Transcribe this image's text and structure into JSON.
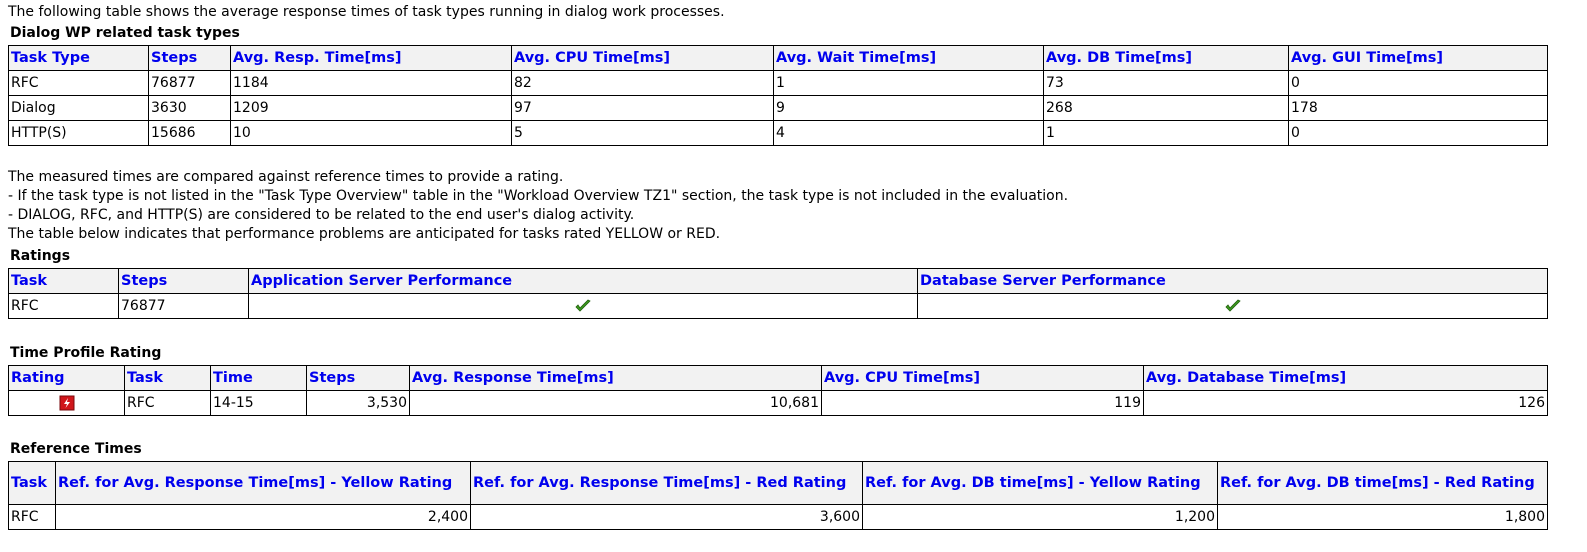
{
  "intro": "The following table shows the average response times of task types running in dialog work processes.",
  "dialog_wp": {
    "title": "Dialog WP related task types",
    "headers": [
      "Task Type",
      "Steps",
      "Avg. Resp. Time[ms]",
      "Avg. CPU Time[ms]",
      "Avg. Wait Time[ms]",
      "Avg. DB Time[ms]",
      "Avg. GUI Time[ms]"
    ],
    "rows": [
      [
        "RFC",
        "76877",
        "1184",
        "82",
        "1",
        "73",
        "0"
      ],
      [
        "Dialog",
        "3630",
        "1209",
        "97",
        "9",
        "268",
        "178"
      ],
      [
        "HTTP(S)",
        "15686",
        "10",
        "5",
        "4",
        "1",
        "0"
      ]
    ]
  },
  "notes": [
    "The measured times are compared against reference times to provide a rating.",
    "- If the task type is not listed in the \"Task Type Overview\" table in the \"Workload Overview TZ1\" section, the task type is not included in the evaluation.",
    "- DIALOG, RFC, and HTTP(S) are considered to be related to the end user's dialog activity.",
    "The table below indicates that performance problems are anticipated for tasks rated YELLOW or RED."
  ],
  "ratings": {
    "title": "Ratings",
    "headers": [
      "Task",
      "Steps",
      "Application Server Performance",
      "Database Server Performance"
    ],
    "rows": [
      {
        "task": "RFC",
        "steps": "76877",
        "app_icon": "green-check-icon",
        "db_icon": "green-check-icon"
      }
    ]
  },
  "time_profile": {
    "title": "Time Profile Rating",
    "headers": [
      "Rating",
      "Task",
      "Time",
      "Steps",
      "Avg. Response Time[ms]",
      "Avg. CPU Time[ms]",
      "Avg. Database Time[ms]"
    ],
    "rows": [
      {
        "rating_icon": "red-rating-icon",
        "task": "RFC",
        "time": "14-15",
        "steps": "3,530",
        "avg_resp": "10,681",
        "avg_cpu": "119",
        "avg_db": "126"
      }
    ]
  },
  "reference": {
    "title": "Reference Times",
    "headers": [
      "Task",
      "Ref. for Avg. Response Time[ms] - Yellow Rating",
      "Ref. for Avg. Response Time[ms] - Red Rating",
      "Ref. for Avg. DB time[ms] - Yellow Rating",
      "Ref. for Avg. DB time[ms] - Red Rating"
    ],
    "rows": [
      [
        "RFC",
        "2,400",
        "3,600",
        "1,200",
        "1,800"
      ]
    ]
  },
  "colors": {
    "header_text": "#0000ee",
    "header_bg": "#f2f2f2",
    "check_green": "#3c9a1e",
    "rating_red": "#d0161b"
  }
}
